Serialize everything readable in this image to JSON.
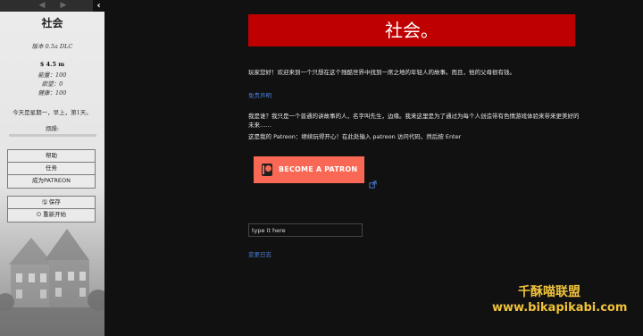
{
  "sidebar": {
    "title": "社会",
    "version": "版本 0.5a DLC",
    "money": "$ 4.5 m",
    "stats": [
      {
        "label": "能量",
        "value": "100"
      },
      {
        "label": "欲望",
        "value": "0"
      },
      {
        "label": "健康",
        "value": "100"
      }
    ],
    "date_line": "今天是星期一，早上，第1天。",
    "cravings_label": "烦躁:",
    "menu": [
      "帮助",
      "任务",
      "成为PATREON"
    ],
    "save_label": "保存",
    "restart_label": "重新开始"
  },
  "main": {
    "banner": "社会。",
    "intro": "玩家您好！欢迎来到一个只想在这个残酷世界中找到一席之地的年轻人的故事。而且，他的父母很有钱。",
    "disclaimer_link": "免责声明",
    "about": "我是谁？我只是一个普通的讲故事的人，名字叫先生，边缘。我来这里是为了通过为每个人创造带有色情游戏体验来带来更美好的未来……",
    "patreon_note": "这是我的 Patreon：继续玩得开心！在此处输入 patreon 访问代码，然后按 Enter",
    "patreon_button": "BECOME A PATRON",
    "code_input_value": "type it here",
    "changelog_link": "变更日志"
  },
  "watermark": {
    "line1": "千酥喵联盟",
    "line2": "www.bikapikabi.com"
  },
  "colors": {
    "banner": "#bf0000",
    "patreon": "#f96854",
    "link": "#4a7fd6",
    "watermark": "#f0c23a"
  }
}
